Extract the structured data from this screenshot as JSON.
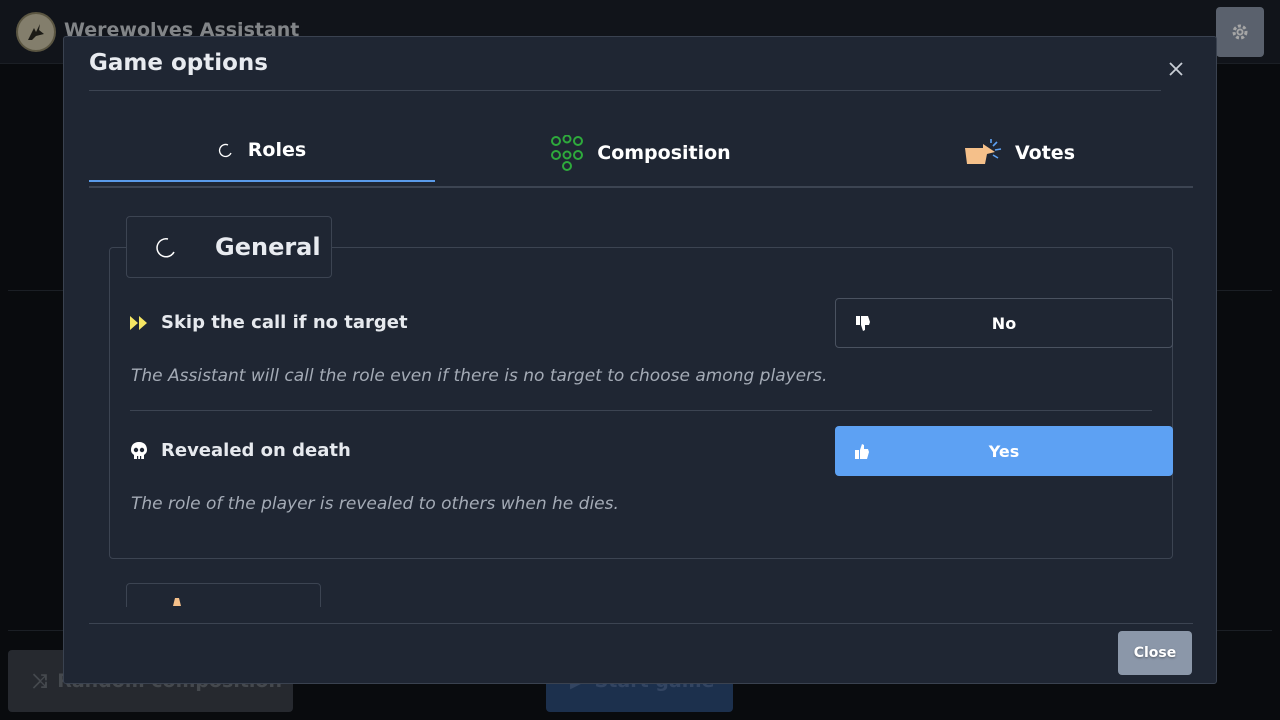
{
  "app": {
    "title": "Werewolves Assistant",
    "random_composition_label": "Random composition",
    "start_game_label": "Start game"
  },
  "modal": {
    "title": "Game options",
    "close_label": "Close"
  },
  "tabs": [
    {
      "label": "Roles",
      "icon": "moon-icon",
      "active": true
    },
    {
      "label": "Composition",
      "icon": "people-group-icon",
      "active": false
    },
    {
      "label": "Votes",
      "icon": "pointing-hand-icon",
      "active": false
    }
  ],
  "sections": {
    "general": {
      "title": "General",
      "options": [
        {
          "label": "Skip the call if no target",
          "icon": "fast-forward-icon",
          "description": "The Assistant will call the role even if there is no target to choose among players.",
          "value": "No",
          "value_icon": "thumbs-down-icon"
        },
        {
          "label": "Revealed on death",
          "icon": "skull-icon",
          "description": "The role of the player is revealed to others when he dies.",
          "value": "Yes",
          "value_icon": "thumbs-up-icon"
        }
      ]
    }
  },
  "colors": {
    "accent": "#5da1f3",
    "modal_bg": "#1f2633",
    "tab_underline": "#5a9bea"
  }
}
